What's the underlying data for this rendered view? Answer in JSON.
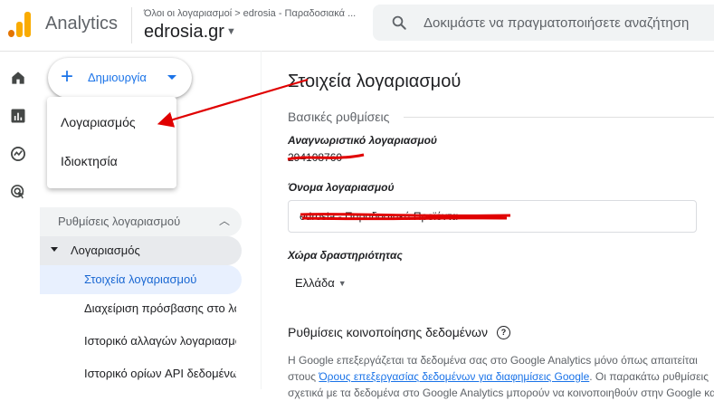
{
  "header": {
    "app_name": "Analytics",
    "breadcrumb": "Όλοι οι λογαριασμοί > edrosia - Παραδοσιακά ...",
    "property_name": "edrosia.gr",
    "search_placeholder": "Δοκιμάστε να πραγματοποιήσετε αναζήτηση"
  },
  "create_button": {
    "label": "Δημιουργία"
  },
  "create_menu": {
    "items": [
      "Λογαριασμός",
      "Ιδιοκτησία"
    ]
  },
  "nav": {
    "section_label": "Ρυθμίσεις λογαριασμού",
    "parent_label": "Λογαριασμός",
    "items": [
      {
        "label": "Στοιχεία λογαριασμού",
        "active": true
      },
      {
        "label": "Διαχείριση πρόσβασης στο λογαριασμό"
      },
      {
        "label": "Ιστορικό αλλαγών λογαριασμού"
      },
      {
        "label": "Ιστορικό ορίων API δεδομένων"
      }
    ]
  },
  "main": {
    "title": "Στοιχεία λογαριασμού",
    "basic_section": "Βασικές ρυθμίσεις",
    "account_id_label": "Αναγνωριστικό λογαριασμού",
    "account_id_value": "294108760",
    "account_name_label": "Όνομα λογαριασμού",
    "account_name_value": "edrosia - Παραδοσιακά Προϊόντα",
    "country_label": "Χώρα δραστηριότητας",
    "country_value": "Ελλάδα",
    "sharing_title": "Ρυθμίσεις κοινοποίησης δεδομένων",
    "sharing_text_1": "Η Google επεξεργάζεται τα δεδομένα σας στο Google Analytics μόνο όπως απαιτείται",
    "sharing_text_2_prefix": "στους ",
    "sharing_link": "Όρους επεξεργασίας δεδομένων για διαφημίσεις Google",
    "sharing_text_2_suffix": ". Οι παρακάτω ρυθμίσεις",
    "sharing_text_3": "σχετικά με τα δεδομένα στο Google Analytics μπορούν να κοινοποιηθούν στην Google και"
  },
  "colors": {
    "accent": "#1a73e8",
    "active_nav_bg": "#e8f0fe",
    "annotation_red": "#e00000",
    "logo_orange": "#f9ab00",
    "logo_dark_orange": "#e37400"
  }
}
